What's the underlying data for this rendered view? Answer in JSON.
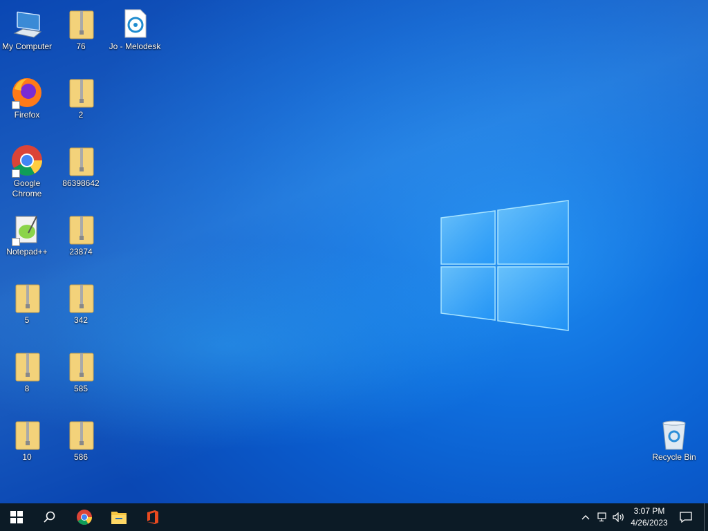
{
  "desktop": {
    "icons": {
      "my_computer": "My Computer",
      "zip_76": "76",
      "melodesk": "Jo - Melodesk",
      "firefox": "Firefox",
      "zip_2": "2",
      "chrome": "Google Chrome",
      "zip_86398642": "86398642",
      "notepadpp": "Notepad++",
      "zip_23874": "23874",
      "zip_5": "5",
      "zip_342": "342",
      "zip_8": "8",
      "zip_585": "585",
      "zip_10": "10",
      "zip_586": "586",
      "recycle_bin": "Recycle Bin"
    }
  },
  "taskbar": {
    "clock": {
      "time": "3:07 PM",
      "date": "4/26/2023"
    },
    "pinned": [
      "windows-start-icon",
      "search-icon",
      "chrome-icon",
      "file-explorer-icon",
      "office-icon"
    ]
  },
  "colors": {
    "accent": "#0a5acb",
    "taskbar": "#0c1b26"
  }
}
